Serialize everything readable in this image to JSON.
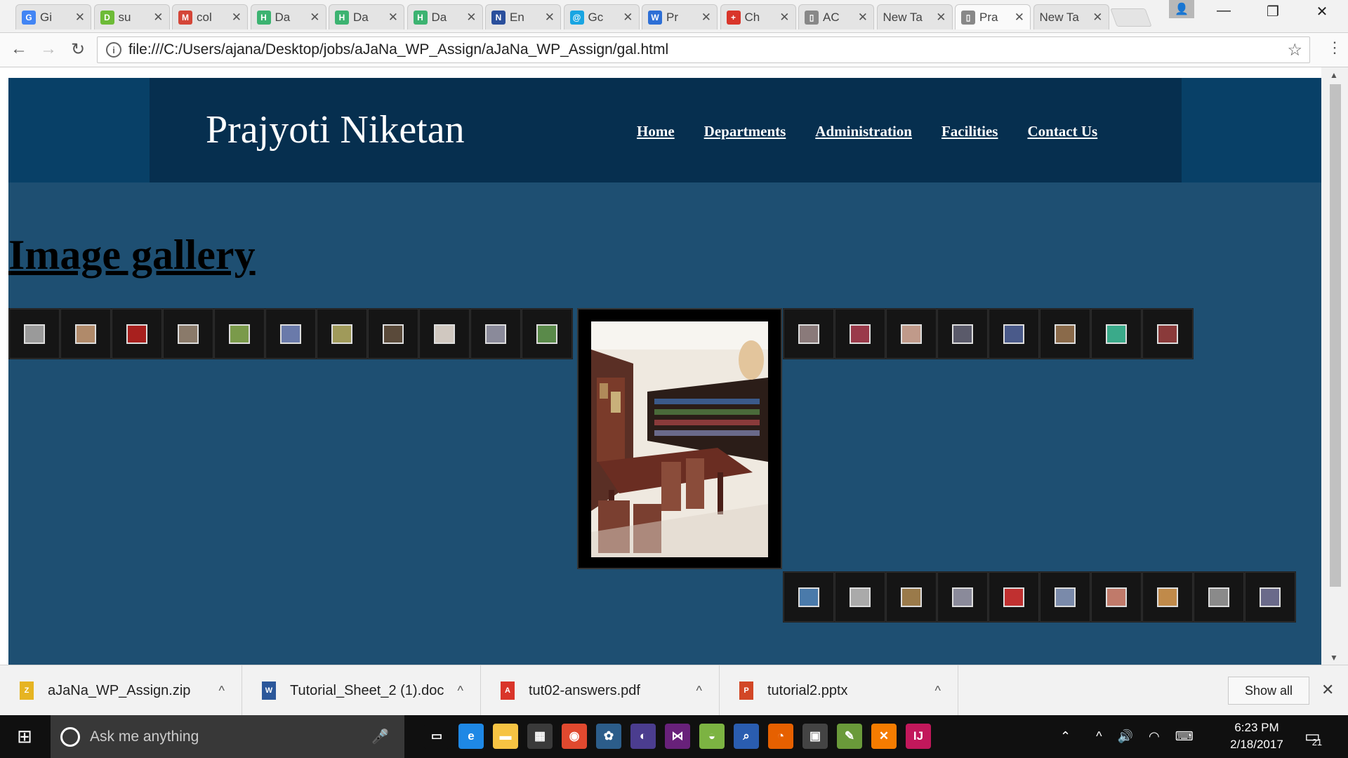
{
  "tabs": [
    {
      "label": "Gi",
      "icon": "google-icon",
      "color": "#4285f4",
      "glyph": "G"
    },
    {
      "label": "su",
      "icon": "doc-green-icon",
      "color": "#6dbb37",
      "glyph": "D"
    },
    {
      "label": "col",
      "icon": "gmail-icon",
      "color": "#d44638",
      "glyph": "M"
    },
    {
      "label": "Da",
      "icon": "hackerrank-icon",
      "color": "#3cb371",
      "glyph": "H"
    },
    {
      "label": "Da",
      "icon": "hackerrank-icon",
      "color": "#3cb371",
      "glyph": "H"
    },
    {
      "label": "Da",
      "icon": "hackerrank-icon",
      "color": "#3cb371",
      "glyph": "H"
    },
    {
      "label": "En",
      "icon": "next-icon",
      "color": "#2a4f9c",
      "glyph": "N"
    },
    {
      "label": "Gc",
      "icon": "att-icon",
      "color": "#19a5e2",
      "glyph": "@"
    },
    {
      "label": "Pr",
      "icon": "w-icon",
      "color": "#2d6fd6",
      "glyph": "W"
    },
    {
      "label": "Ch",
      "icon": "cross-icon",
      "color": "#d9352a",
      "glyph": "+"
    },
    {
      "label": "AC",
      "icon": "page-icon",
      "color": "#888888",
      "glyph": "▯"
    },
    {
      "label": "New Ta",
      "icon": "",
      "color": "",
      "glyph": ""
    },
    {
      "label": "Pra",
      "icon": "page-icon",
      "color": "#888888",
      "glyph": "▯"
    },
    {
      "label": "New Ta",
      "icon": "",
      "color": "",
      "glyph": ""
    }
  ],
  "browser": {
    "url": "file:///C:/Users/ajana/Desktop/jobs/aJaNa_WP_Assign/aJaNa_WP_Assign/gal.html"
  },
  "site": {
    "title": "Prajyoti Niketan",
    "nav": [
      "Home",
      "Departments",
      "Administration",
      "Facilities",
      "Contact Us"
    ],
    "gallery_heading": "Image gallery"
  },
  "gallery": {
    "strip_top_left_colors": [
      "#9a9a9a",
      "#b08a6a",
      "#a8201e",
      "#8a7a6a",
      "#7a9a4a",
      "#6a7aaa",
      "#a09a5a",
      "#5a4a3a",
      "#d0c8c0",
      "#8a8a9a",
      "#5a8a4a"
    ],
    "strip_top_right_colors": [
      "#8a7a7a",
      "#9a3a4a",
      "#c09a8a",
      "#5a5a6a",
      "#4a5a8a",
      "#8a6a4a",
      "#3aaa8a",
      "#8a3a3a"
    ],
    "strip_bottom_colors": [
      "#4a7aaa",
      "#aaaaaa",
      "#9a7a4a",
      "#8a8a9a",
      "#c03030",
      "#7a8aaa",
      "#c07a6a",
      "#c08a4a",
      "#8a8a8a",
      "#6a6a8a"
    ]
  },
  "downloads": [
    {
      "name": "aJaNa_WP_Assign.zip",
      "icon": "zip-icon",
      "color": "#e6b422"
    },
    {
      "name": "Tutorial_Sheet_2 (1).doc",
      "icon": "word-icon",
      "color": "#2b579a"
    },
    {
      "name": "tut02-answers.pdf",
      "icon": "pdf-icon",
      "color": "#d9352a"
    },
    {
      "name": "tutorial2.pptx",
      "icon": "powerpoint-icon",
      "color": "#d24726"
    }
  ],
  "downloads_bar": {
    "show_all": "Show all"
  },
  "taskbar": {
    "search_placeholder": "Ask me anything",
    "time": "6:23 PM",
    "date": "2/18/2017",
    "notifications": "21",
    "apps": [
      {
        "name": "task-view-icon",
        "glyph": "▭",
        "color": "#101010"
      },
      {
        "name": "edge-icon",
        "glyph": "e",
        "color": "#1e88e5"
      },
      {
        "name": "file-explorer-icon",
        "glyph": "▬",
        "color": "#f6c343"
      },
      {
        "name": "store-icon",
        "glyph": "▦",
        "color": "#3a3a3a"
      },
      {
        "name": "chrome-icon",
        "glyph": "◉",
        "color": "#e0492f"
      },
      {
        "name": "app-icon",
        "glyph": "✿",
        "color": "#2c5d8a"
      },
      {
        "name": "eclipse-icon",
        "glyph": "◐",
        "color": "#4b3d8f"
      },
      {
        "name": "visual-studio-icon",
        "glyph": "⋈",
        "color": "#68217a"
      },
      {
        "name": "android-icon",
        "glyph": "◒",
        "color": "#7cb342"
      },
      {
        "name": "search-tool-icon",
        "glyph": "⌕",
        "color": "#2a5db0"
      },
      {
        "name": "firefox-icon",
        "glyph": "◔",
        "color": "#e66000"
      },
      {
        "name": "terminal-icon",
        "glyph": "▣",
        "color": "#444444"
      },
      {
        "name": "notepad-icon",
        "glyph": "✎",
        "color": "#6a9a3a"
      },
      {
        "name": "xampp-icon",
        "glyph": "✕",
        "color": "#f57c00"
      },
      {
        "name": "intellij-icon",
        "glyph": "IJ",
        "color": "#c2185b"
      }
    ]
  }
}
